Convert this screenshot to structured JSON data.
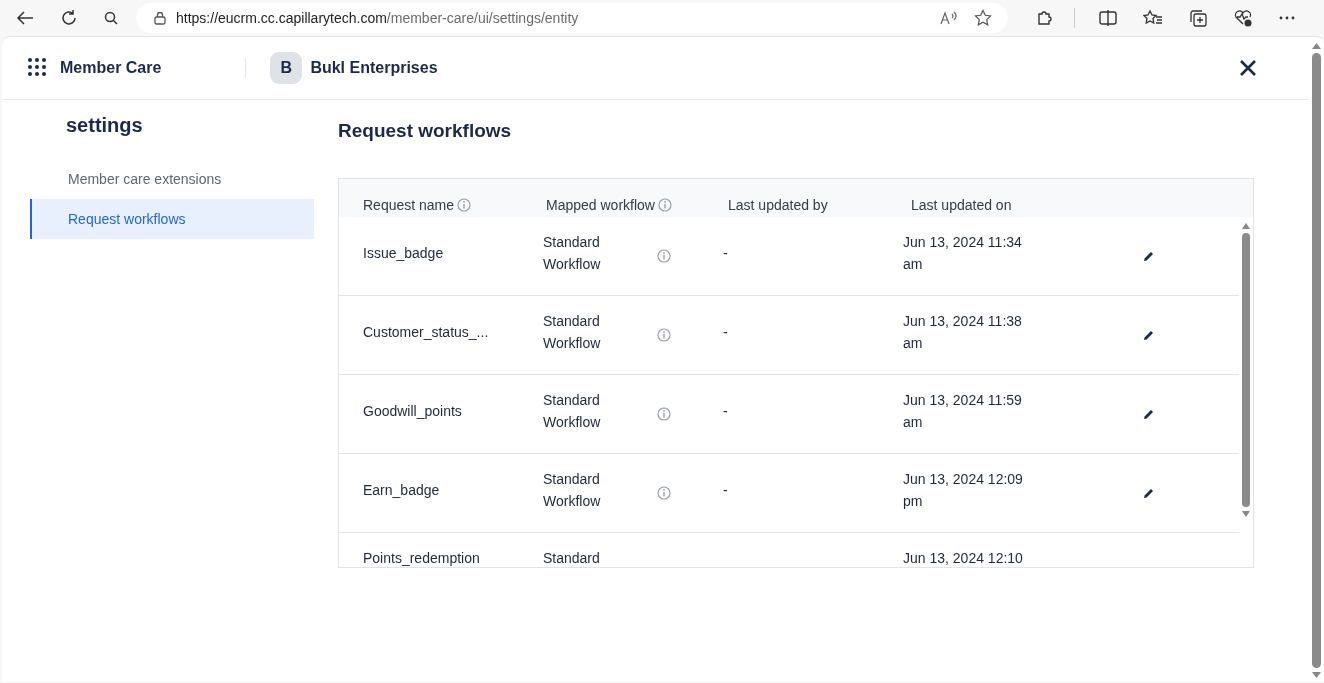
{
  "browser": {
    "url_host": "https://eucrm.cc.capillarytech.com",
    "url_path": "/member-care/ui/settings/entity"
  },
  "header": {
    "app_name": "Member Care",
    "org_initial": "B",
    "org_name": "Bukl Enterprises"
  },
  "sidebar": {
    "title": "settings",
    "items": [
      {
        "label": "Member care extensions",
        "selected": false
      },
      {
        "label": "Request workflows",
        "selected": true
      }
    ]
  },
  "main": {
    "title": "Request workflows"
  },
  "table": {
    "columns": [
      {
        "label": "Request name",
        "info": true
      },
      {
        "label": "Mapped workflow",
        "info": true
      },
      {
        "label": "Last updated by",
        "info": false
      },
      {
        "label": "Last updated on",
        "info": false
      }
    ],
    "rows": [
      {
        "name": "Issue_badge",
        "workflow": "Standard Workflow",
        "updated_by": "-",
        "updated_on": "Jun 13, 2024 11:34 am"
      },
      {
        "name": "Customer_status_...",
        "workflow": "Standard Workflow",
        "updated_by": "-",
        "updated_on": "Jun 13, 2024 11:38 am"
      },
      {
        "name": "Goodwill_points",
        "workflow": "Standard Workflow",
        "updated_by": "-",
        "updated_on": "Jun 13, 2024 11:59 am"
      },
      {
        "name": "Earn_badge",
        "workflow": "Standard Workflow",
        "updated_by": "-",
        "updated_on": "Jun 13, 2024 12:09 pm"
      },
      {
        "name": "Points_redemption",
        "workflow": "Standard",
        "updated_on": "Jun 13, 2024 12:10"
      }
    ]
  }
}
